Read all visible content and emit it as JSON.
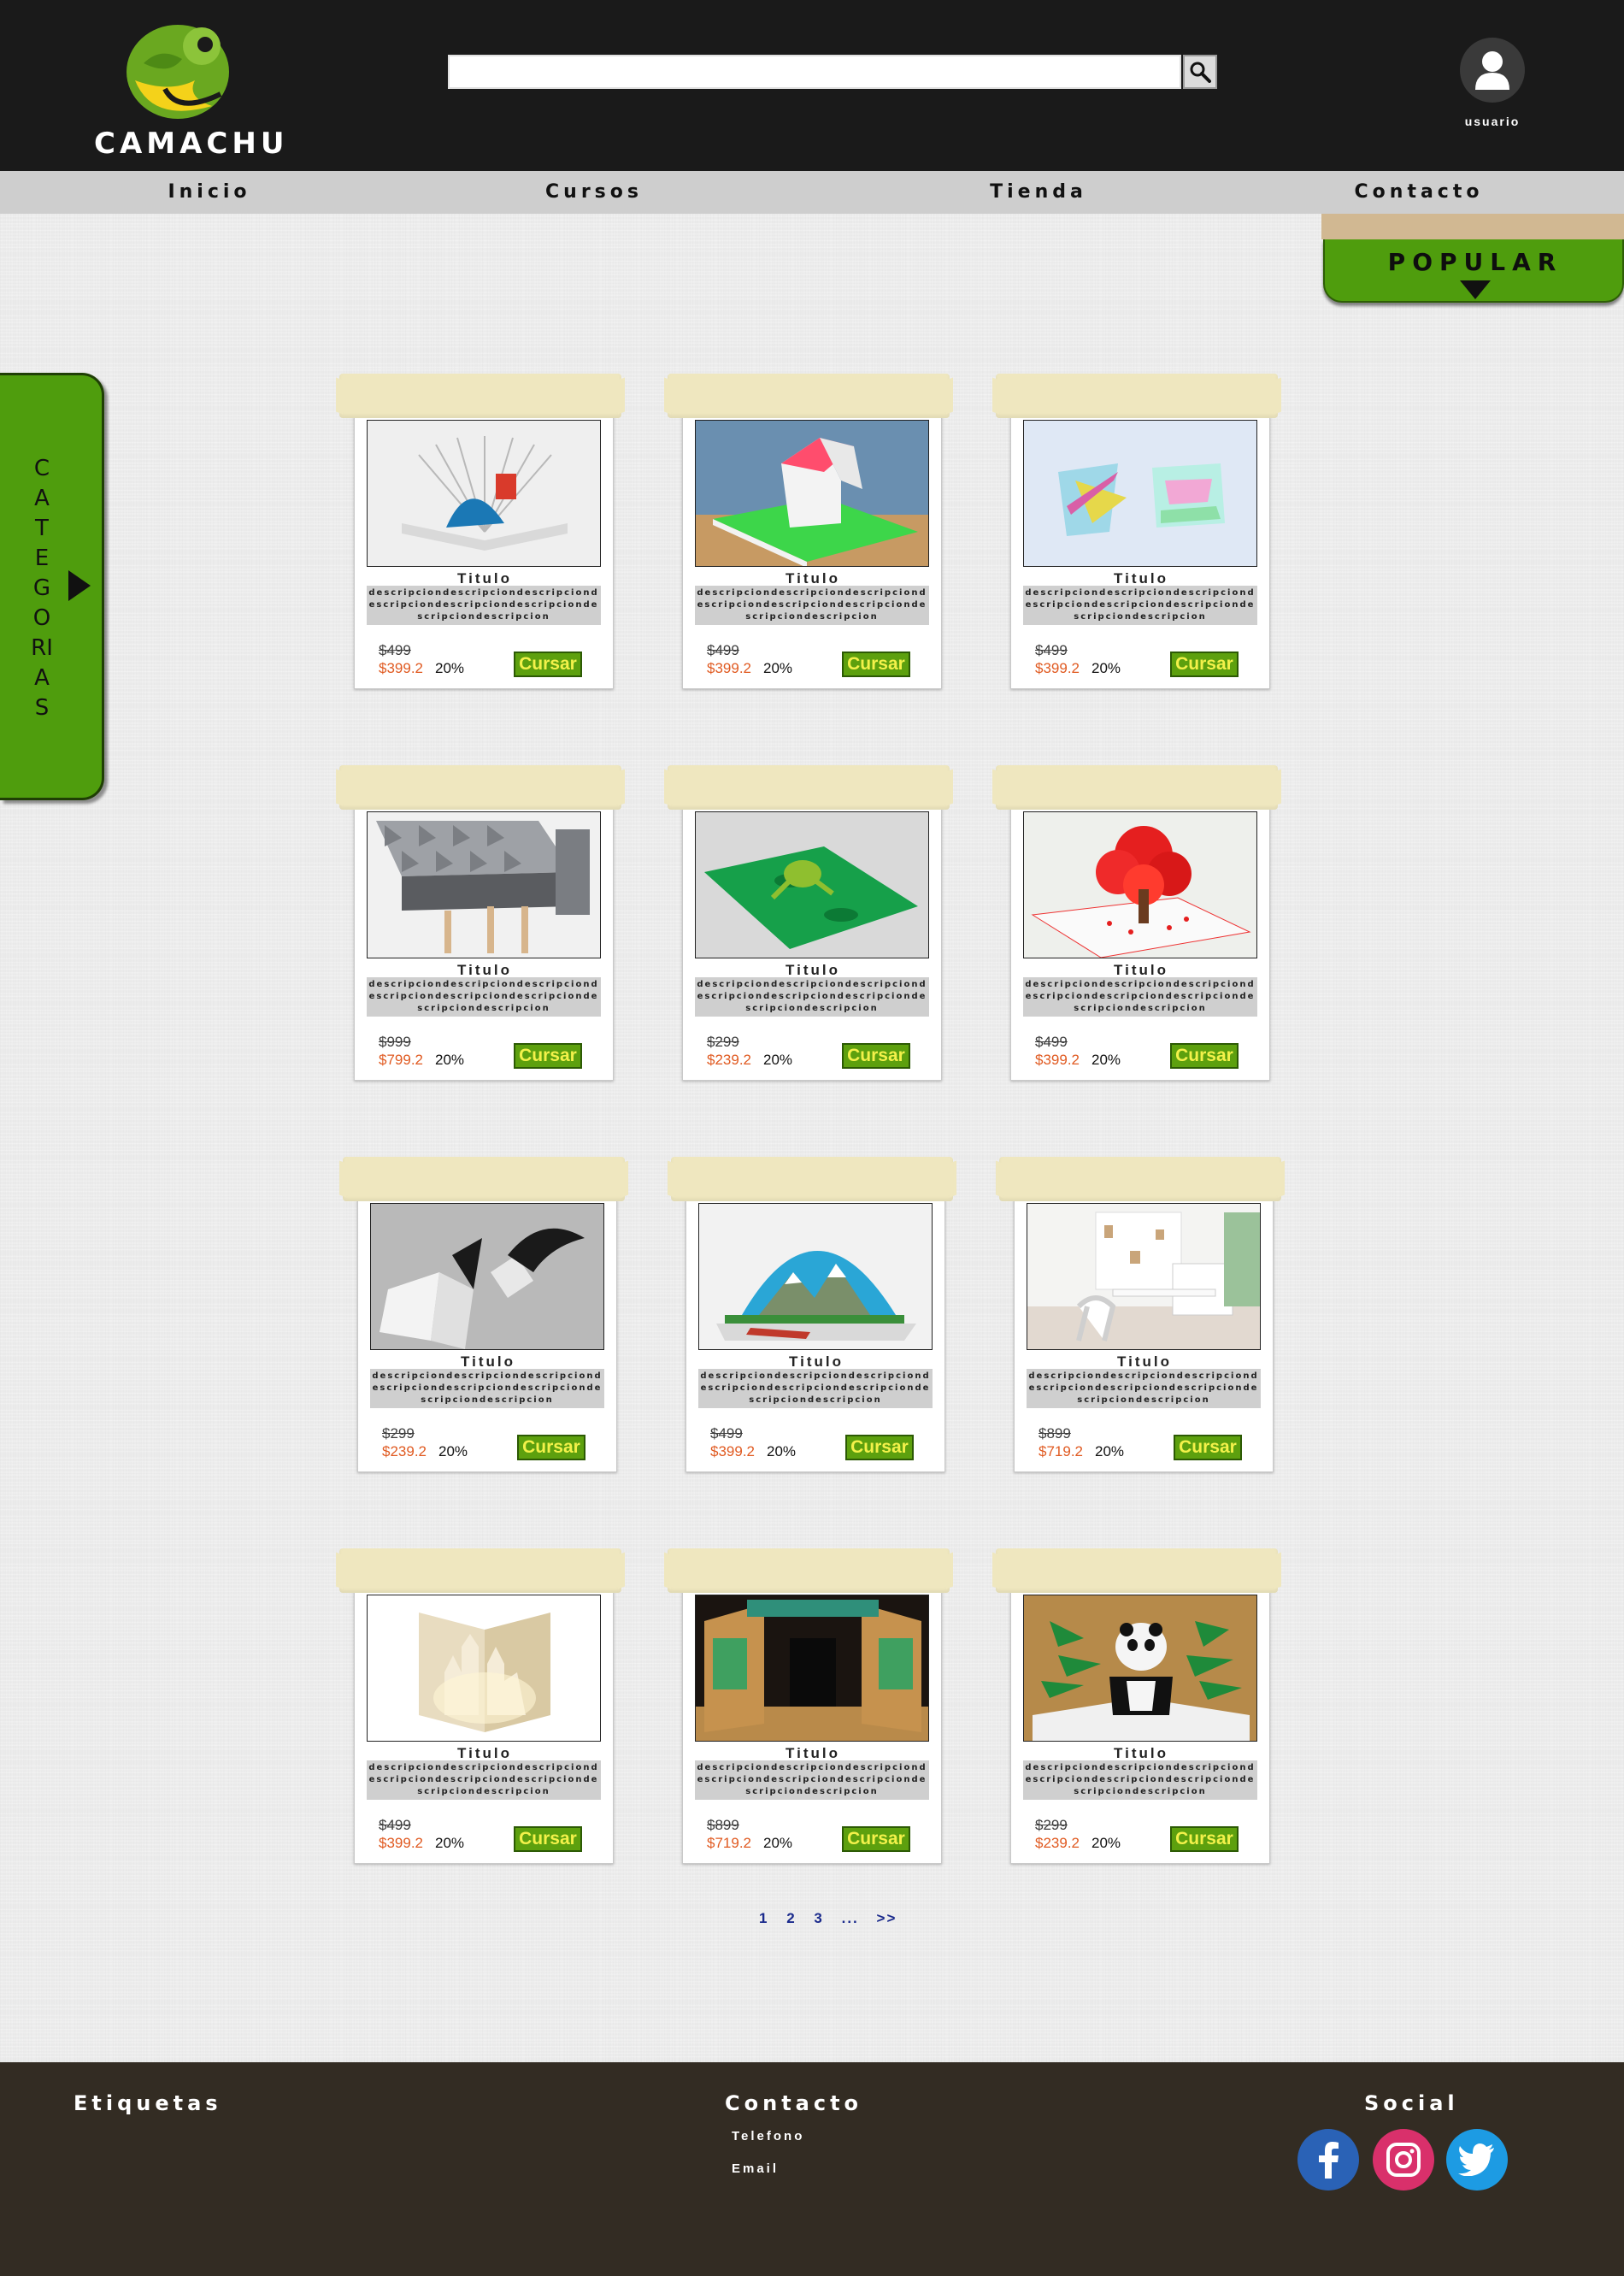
{
  "header": {
    "logo_text": "CAMACHU",
    "search": {
      "value": "",
      "placeholder": ""
    },
    "user_label": "usuario"
  },
  "nav": {
    "items": [
      {
        "label": "Inicio"
      },
      {
        "label": "Cursos"
      },
      {
        "label": "Tienda"
      },
      {
        "label": "Contacto"
      }
    ]
  },
  "popular": {
    "label": "POPULAR"
  },
  "categories": {
    "label": "CATEGORIAS"
  },
  "products": [
    {
      "title": "Titulo",
      "description": "descripciondescripciondescripciondescripciondescripciondescripciondescripciondescripcion",
      "old_price": "$499",
      "price": "$399.2",
      "discount": "20%",
      "button": "Cursar",
      "image": "pop-up book with blue fan"
    },
    {
      "title": "Titulo",
      "description": "descripciondescripciondescripciondescripciondescripciondescripciondescripciondescripcion",
      "old_price": "$499",
      "price": "$399.2",
      "discount": "20%",
      "button": "Cursar",
      "image": "pop-up paper house"
    },
    {
      "title": "Titulo",
      "description": "descripciondescripciondescripciondescripciondescripciondescripciondescripciondescripcion",
      "old_price": "$499",
      "price": "$399.2",
      "discount": "20%",
      "button": "Cursar",
      "image": "pop-up letters"
    },
    {
      "title": "Titulo",
      "description": "descripciondescripciondescripciondescripciondescripciondescripciondescripciondescripcion",
      "old_price": "$999",
      "price": "$799.2",
      "discount": "20%",
      "button": "Cursar",
      "image": "folded geometric pattern"
    },
    {
      "title": "Titulo",
      "description": "descripciondescripciondescripciondescripciondescripciondescripciondescripciondescripcion",
      "old_price": "$299",
      "price": "$239.2",
      "discount": "20%",
      "button": "Cursar",
      "image": "pop-up frog card"
    },
    {
      "title": "Titulo",
      "description": "descripciondescripciondescripciondescripciondescripciondescripciondescripciondescripcion",
      "old_price": "$499",
      "price": "$399.2",
      "discount": "20%",
      "button": "Cursar",
      "image": "red tree pop-up card"
    },
    {
      "title": "Titulo",
      "description": "descripciondescripciondescripciondescripciondescripciondescripciondescripciondescripcion",
      "old_price": "$299",
      "price": "$239.2",
      "discount": "20%",
      "button": "Cursar",
      "image": "black wing pop-up cards"
    },
    {
      "title": "Titulo",
      "description": "descripciondescripciondescripciondescripciondescripciondescripciondescripciondescripcion",
      "old_price": "$499",
      "price": "$399.2",
      "discount": "20%",
      "button": "Cursar",
      "image": "mountain landscape pop-up book"
    },
    {
      "title": "Titulo",
      "description": "descripciondescripciondescripciondescripciondescripciondescripciondescripciondescripcion",
      "old_price": "$899",
      "price": "$719.2",
      "discount": "20%",
      "button": "Cursar",
      "image": "white desk room"
    },
    {
      "title": "Titulo",
      "description": "descripciondescripciondescripciondescripciondescripciondescripciondescripciondescripcion",
      "old_price": "$499",
      "price": "$399.2",
      "discount": "20%",
      "button": "Cursar",
      "image": "paper castle pop-up"
    },
    {
      "title": "Titulo",
      "description": "descripciondescripciondescripciondescripciondescripciondescripciondescripciondescripcion",
      "old_price": "$899",
      "price": "$719.2",
      "discount": "20%",
      "button": "Cursar",
      "image": "pop-up room scene"
    },
    {
      "title": "Titulo",
      "description": "descripciondescripciondescripciondescripciondescripciondescripciondescripciondescripcion",
      "old_price": "$299",
      "price": "$239.2",
      "discount": "20%",
      "button": "Cursar",
      "image": "panda bamboo pop-up"
    }
  ],
  "pagination": {
    "pages": [
      "1",
      "2",
      "3",
      "...",
      ">>"
    ]
  },
  "footer": {
    "etiquetas": {
      "title": "Etiquetas"
    },
    "contacto": {
      "title": "Contacto",
      "phone_label": "Telefono",
      "email_label": "Email"
    },
    "social": {
      "title": "Social",
      "icons": [
        "facebook-icon",
        "instagram-icon",
        "twitter-icon"
      ]
    }
  },
  "colors": {
    "header_bg": "#1a1a1a",
    "nav_bg": "#cecece",
    "accent_green": "#4f9d0d",
    "button_text": "#f3f14a",
    "price_color": "#e05a21",
    "footer_bg": "#332c23"
  }
}
